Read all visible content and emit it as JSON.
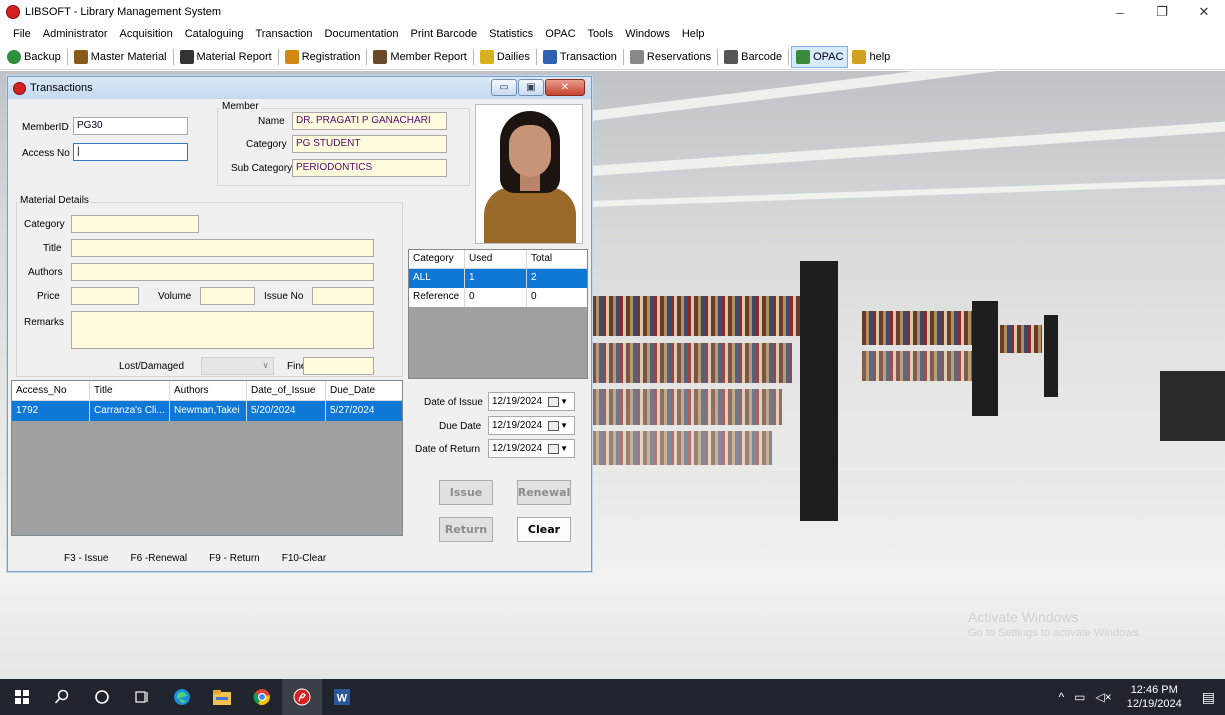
{
  "app": {
    "title": "LIBSOFT - Library Management System",
    "window_controls": [
      "–",
      "❐",
      "✕"
    ]
  },
  "menu": [
    "File",
    "Administrator",
    "Acquisition",
    "Cataloguing",
    "Transaction",
    "Documentation",
    "Print Barcode",
    "Statistics",
    "OPAC",
    "Tools",
    "Windows",
    "Help"
  ],
  "toolbar": [
    {
      "label": "Backup",
      "icon": "backup-icon",
      "color": "#2f8f3a"
    },
    {
      "label": "Master Material",
      "icon": "books-icon",
      "color": "#8a5a1a"
    },
    {
      "label": "Material Report",
      "icon": "binoculars-icon",
      "color": "#333333"
    },
    {
      "label": "Registration",
      "icon": "registration-icon",
      "color": "#d08a10"
    },
    {
      "label": "Member Report",
      "icon": "members-icon",
      "color": "#6a4a2a"
    },
    {
      "label": "Dailies",
      "icon": "dailies-icon",
      "color": "#d8b020"
    },
    {
      "label": "Transaction",
      "icon": "handshake-icon",
      "color": "#3060b0"
    },
    {
      "label": "Reservations",
      "icon": "reservations-icon",
      "color": "#888888"
    },
    {
      "label": "Barcode",
      "icon": "barcode-icon",
      "color": "#555555"
    },
    {
      "label": "OPAC",
      "icon": "opac-icon",
      "color": "#3a8a3a"
    },
    {
      "label": "help",
      "icon": "help-icon",
      "color": "#d0a020"
    }
  ],
  "tx": {
    "title": "Transactions",
    "controls": [
      "▭",
      "▣",
      "✕"
    ],
    "member_id_label": "MemberID",
    "member_id": "PG30",
    "access_no_label": "Access No",
    "access_no": "|",
    "member_group": "Member",
    "name_label": "Name",
    "name": "DR. PRAGATI P GANACHARI",
    "category_label": "Category",
    "category": "PG STUDENT",
    "subcat_label": "Sub Category",
    "subcat": "PERIODONTICS",
    "material_group": "Material Details",
    "m_category_label": "Category",
    "title_label": "Title",
    "authors_label": "Authors",
    "price_label": "Price",
    "volume_label": "Volume",
    "issue_no_label": "Issue No",
    "remarks_label": "Remarks",
    "lost_label": "Lost/Damaged",
    "fine_label": "Fine",
    "cat_table": {
      "headers": [
        "Category",
        "Used",
        "Total"
      ],
      "rows": [
        [
          "ALL",
          "1",
          "2"
        ],
        [
          "Reference",
          "0",
          "0"
        ]
      ]
    },
    "issued_list": {
      "headers": [
        "Access_No",
        "Title",
        "Authors",
        "Date_of_Issue",
        "Due_Date"
      ],
      "rows": [
        [
          "1792",
          "Carranza's Cli...",
          "Newman,Takei",
          "5/20/2024",
          "5/27/2024"
        ]
      ]
    },
    "date_of_issue_label": "Date of Issue",
    "date_of_issue": "12/19/2024",
    "due_date_label": "Due Date",
    "due_date": "12/19/2024",
    "date_of_return_label": "Date of Return",
    "date_of_return": "12/19/2024",
    "issue_btn": "Issue",
    "renewal_btn": "Renewal",
    "return_btn": "Return",
    "clear_btn": "Clear",
    "hotkeys": [
      "F3 - Issue",
      "F6 -Renewal",
      "F9 - Return",
      "F10-Clear"
    ]
  },
  "watermark": {
    "line1": "Activate Windows",
    "line2": "Go to Settings to activate Windows."
  },
  "taskbar": {
    "time": "12:46 PM",
    "date": "12/19/2024"
  }
}
